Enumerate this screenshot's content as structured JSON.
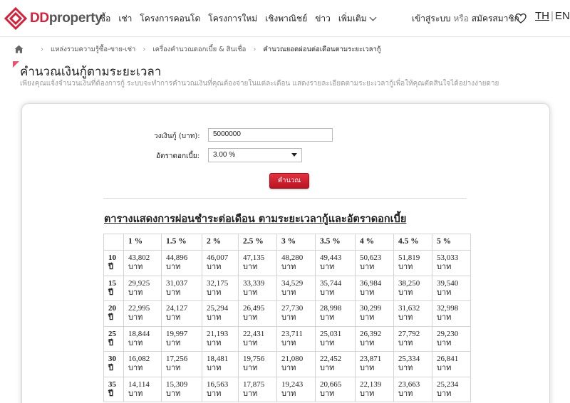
{
  "brand": {
    "name_red": "DD",
    "name_gray": "property",
    "brand_color": "#d3213a"
  },
  "nav": {
    "items": [
      "ซื้อ",
      "เช่า",
      "โครงการคอนโด",
      "โครงการใหม่",
      "เชิงพาณิชย์",
      "ข่าว"
    ],
    "more_label": "เพิ่มเติม"
  },
  "account": {
    "login": "เข้าสู่ระบบ",
    "or": "หรือ",
    "register": "สมัครสมาชิก"
  },
  "lang": {
    "th": "TH",
    "sep": "|",
    "en": "EN"
  },
  "breadcrumb": {
    "items": [
      "แหล่งรวมความรู้ซื้อ-ขาย-เช่า",
      "เครื่องคำนวณดอกเบี้ย & สินเชื่อ",
      "คำนวณยอดผ่อนต่อเดือนตามระยะเวลากู้"
    ]
  },
  "page": {
    "title": "คำนวณเงินกู้ตามระยะเวลา",
    "description": "เพียงคุณแจ้งจำนวนเงินที่ต้องการกู้ ระบบจะทำการคำนวณเงินที่คุณต้องจ่ายในแต่ละเดือน แสดงรายละเอียดตามระยะเวลากู้เพื่อให้คุณตัดสินใจได้อย่างง่ายดาย"
  },
  "form": {
    "amount_label": "วงเงินกู้ (บาท):",
    "amount_value": "5000000",
    "rate_label": "อัตราดอกเบี้ย:",
    "rate_value": "3.00 %",
    "submit_label": "คำนวณ"
  },
  "table": {
    "title": "ตารางแสดงการผ่อนชำระต่อเดือน ตามระยะเวลากู้และอัตราดอกเบี้ย",
    "headers": [
      "",
      "1 %",
      "1.5 %",
      "2 %",
      "2.5 %",
      "3 %",
      "3.5 %",
      "4 %",
      "4.5 %",
      "5 %"
    ],
    "unit": "บาท",
    "year_unit": "ปี",
    "rows": [
      {
        "years": "10",
        "values": [
          "43,802",
          "44,896",
          "46,007",
          "47,135",
          "48,280",
          "49,443",
          "50,623",
          "51,819",
          "53,033"
        ]
      },
      {
        "years": "15",
        "values": [
          "29,925",
          "31,037",
          "32,175",
          "33,339",
          "34,529",
          "35,744",
          "36,984",
          "38,250",
          "39,540"
        ]
      },
      {
        "years": "20",
        "values": [
          "22,995",
          "24,127",
          "25,294",
          "26,495",
          "27,730",
          "28,998",
          "30,299",
          "31,632",
          "32,998"
        ]
      },
      {
        "years": "25",
        "values": [
          "18,844",
          "19,997",
          "21,193",
          "22,431",
          "23,711",
          "25,031",
          "26,392",
          "27,792",
          "29,230"
        ]
      },
      {
        "years": "30",
        "values": [
          "16,082",
          "17,256",
          "18,481",
          "19,756",
          "21,080",
          "22,452",
          "23,871",
          "25,334",
          "26,841"
        ]
      },
      {
        "years": "35",
        "values": [
          "14,114",
          "15,309",
          "16,563",
          "17,875",
          "19,243",
          "20,665",
          "22,139",
          "23,663",
          "25,234"
        ]
      }
    ]
  }
}
